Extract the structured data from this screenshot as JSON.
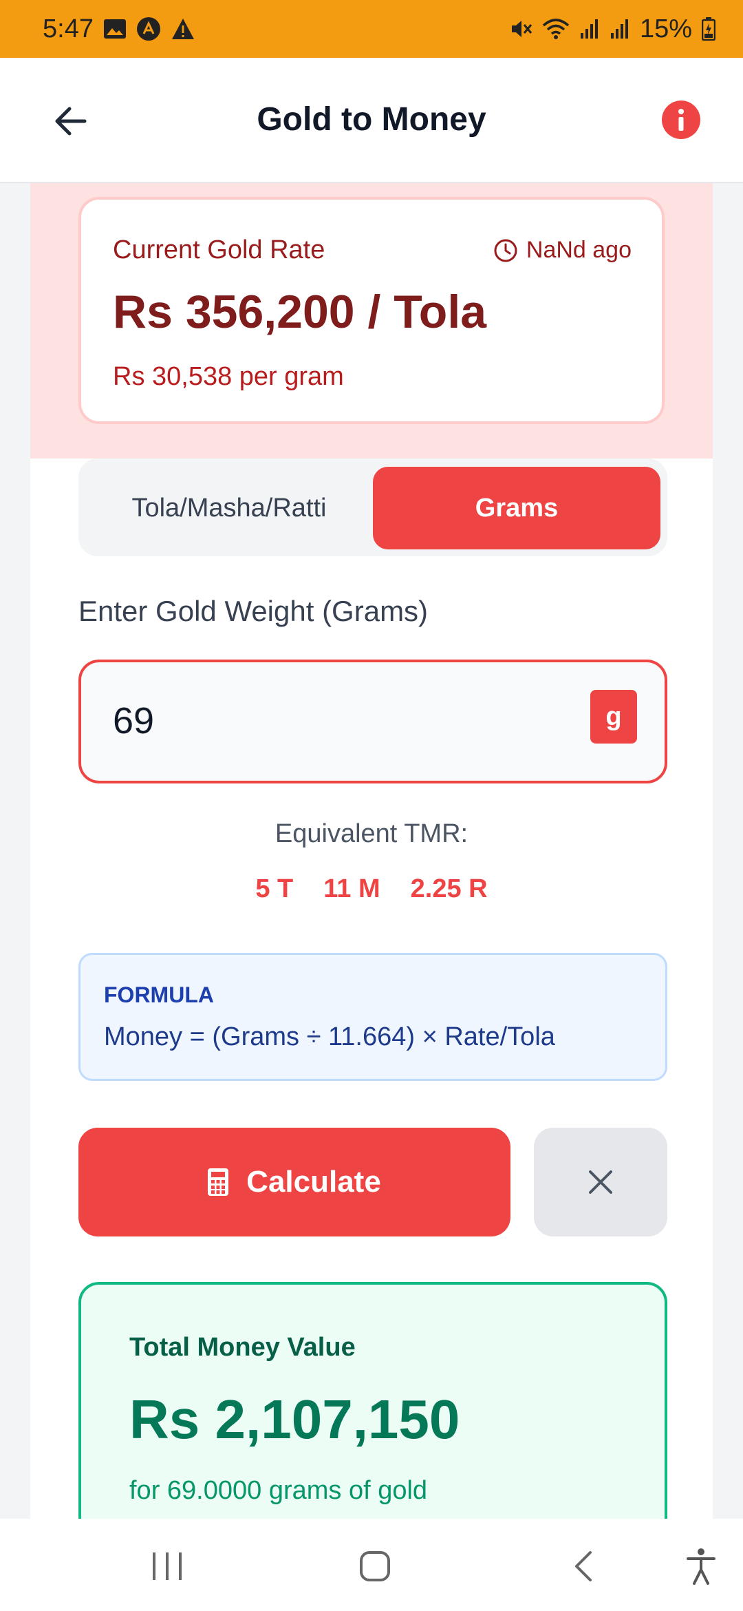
{
  "status_bar": {
    "time": "5:47",
    "battery": "15%",
    "icons": [
      "image-icon",
      "app-notification-icon",
      "warning-icon",
      "mute-icon",
      "wifi-icon",
      "signal-icon",
      "signal-icon",
      "battery-charging-icon"
    ]
  },
  "header": {
    "title": "Gold to Money",
    "back_icon": "arrow-left-icon",
    "info_icon": "info-icon"
  },
  "rate_card": {
    "label": "Current Gold Rate",
    "updated": "NaNd ago",
    "rate": "Rs 356,200 / Tola",
    "per_gram": "Rs 30,538 per gram"
  },
  "unit_toggle": {
    "options": [
      "Tola/Masha/Ratti",
      "Grams"
    ],
    "selected": "Grams"
  },
  "weight_input": {
    "label": "Enter Gold Weight (Grams)",
    "value": "69",
    "unit": "g"
  },
  "equivalent": {
    "label": "Equivalent TMR:",
    "tola": "5 T",
    "masha": "11 M",
    "ratti": "2.25 R"
  },
  "formula": {
    "title": "FORMULA",
    "text": "Money = (Grams ÷ 11.664) × Rate/Tola"
  },
  "actions": {
    "calculate_label": "Calculate",
    "calculate_icon": "calculator-icon",
    "clear_icon": "close-icon"
  },
  "result": {
    "label": "Total Money Value",
    "value": "Rs 2,107,150",
    "sub": "for 69.0000 grams of gold"
  },
  "colors": {
    "status_bar": "#f39c12",
    "accent": "#ef4444",
    "success": "#10b981"
  }
}
